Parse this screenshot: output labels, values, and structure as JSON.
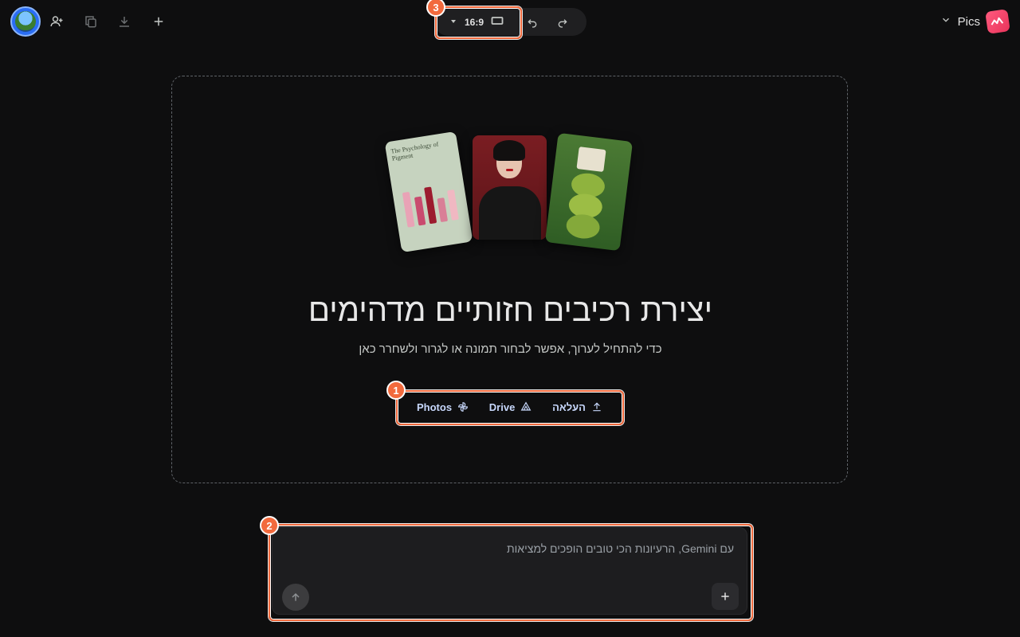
{
  "topbar": {
    "avatar": "user-avatar",
    "icons": [
      "add-person-icon",
      "copy-icon",
      "download-icon",
      "plus-icon"
    ],
    "aspect_ratio": "16:9",
    "undo_icon": "undo-icon",
    "redo_icon": "redo-icon",
    "brand_name": "Pics"
  },
  "hero": {
    "preview_card_title": "The Psychology of Pigment",
    "headline": "יצירת רכיבים חזותיים מדהימים",
    "subline": "כדי להתחיל לערוך, אפשר לבחור תמונה או לגרור ולשחרר כאן"
  },
  "sources": {
    "photos": "Photos",
    "drive": "Drive",
    "upload": "העלאה"
  },
  "prompt": {
    "placeholder": "עם Gemini, הרעיונות הכי טובים הופכים למציאות"
  },
  "annotations": {
    "badge1": "1",
    "badge2": "2",
    "badge3": "3"
  },
  "colors": {
    "background": "#0e0e0f",
    "accent_highlight": "#f26a3d",
    "link_blue": "#c7d7fb",
    "brand_red": "#e9345b"
  }
}
